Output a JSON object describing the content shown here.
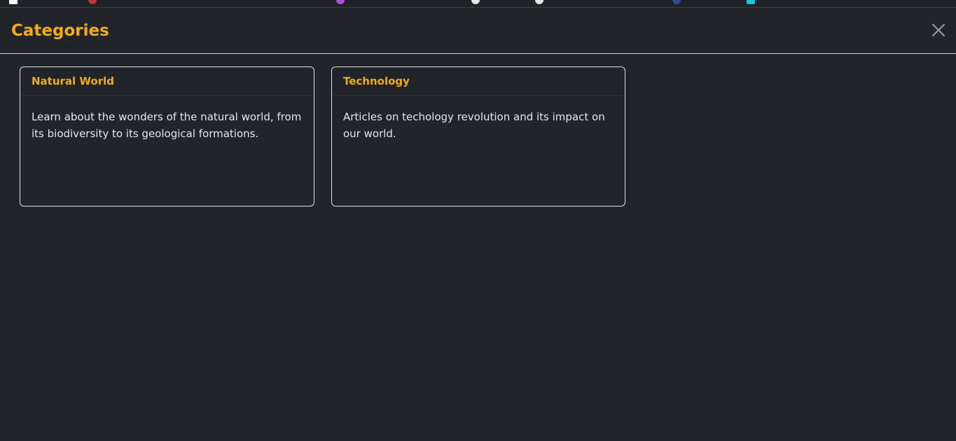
{
  "modal": {
    "title": "Categories",
    "close_icon": "close-icon"
  },
  "categories": [
    {
      "title": "Natural World",
      "description": "Learn about the wonders of the natural world, from its biodiversity to its geological formations."
    },
    {
      "title": "Technology",
      "description": "Articles on techology revolution and its impact on our world."
    }
  ],
  "colors": {
    "background": "#212429",
    "accent": "#f0ad16",
    "card_border": "#dfe2e6",
    "text": "#e3e6ea"
  }
}
